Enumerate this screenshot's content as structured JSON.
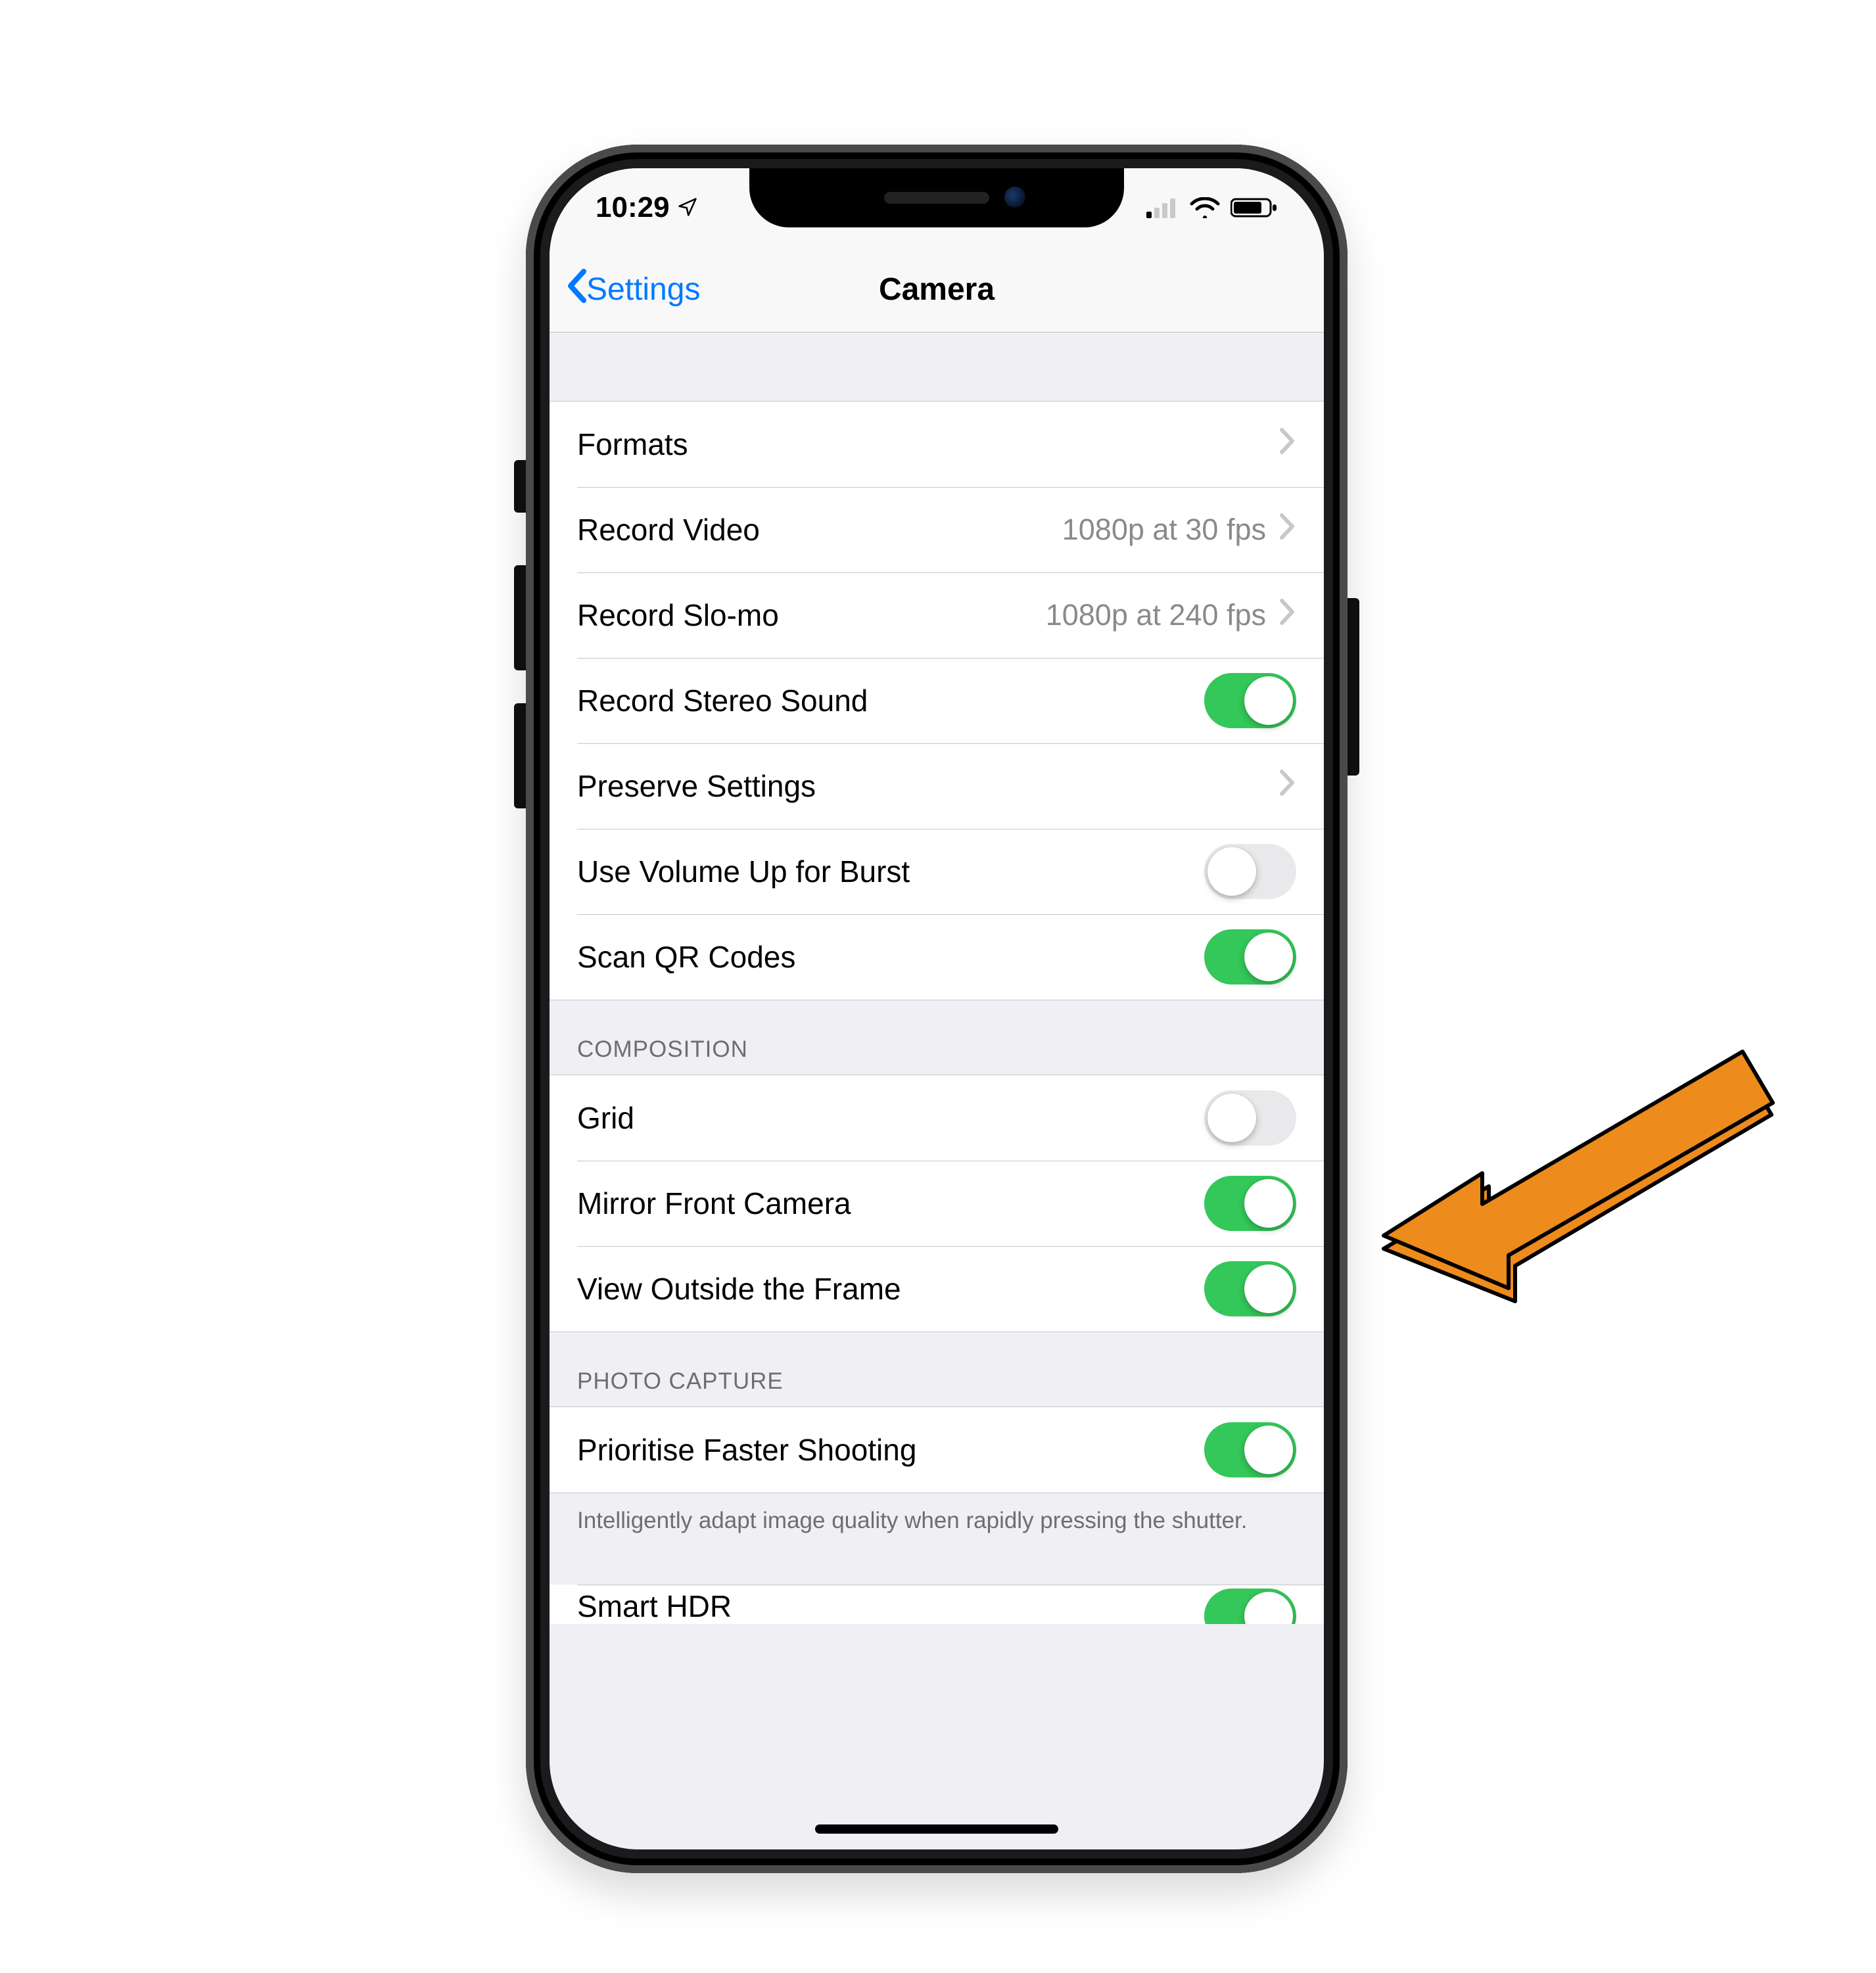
{
  "status": {
    "time": "10:29",
    "location_icon": "location-arrow"
  },
  "nav": {
    "title": "Camera",
    "back": "Settings"
  },
  "section1": {
    "items": [
      {
        "label": "Formats",
        "type": "link",
        "value": ""
      },
      {
        "label": "Record Video",
        "type": "link",
        "value": "1080p at 30 fps"
      },
      {
        "label": "Record Slo-mo",
        "type": "link",
        "value": "1080p at 240 fps"
      },
      {
        "label": "Record Stereo Sound",
        "type": "toggle",
        "on": true
      },
      {
        "label": "Preserve Settings",
        "type": "link",
        "value": ""
      },
      {
        "label": "Use Volume Up for Burst",
        "type": "toggle",
        "on": false
      },
      {
        "label": "Scan QR Codes",
        "type": "toggle",
        "on": true
      }
    ]
  },
  "section2": {
    "header": "COMPOSITION",
    "items": [
      {
        "label": "Grid",
        "type": "toggle",
        "on": false
      },
      {
        "label": "Mirror Front Camera",
        "type": "toggle",
        "on": true
      },
      {
        "label": "View Outside the Frame",
        "type": "toggle",
        "on": true
      }
    ]
  },
  "section3": {
    "header": "PHOTO CAPTURE",
    "items": [
      {
        "label": "Prioritise Faster Shooting",
        "type": "toggle",
        "on": true
      }
    ],
    "footer": "Intelligently adapt image quality when rapidly pressing the shutter."
  },
  "section4": {
    "items": [
      {
        "label": "Smart HDR",
        "type": "toggle",
        "on": true
      }
    ]
  }
}
